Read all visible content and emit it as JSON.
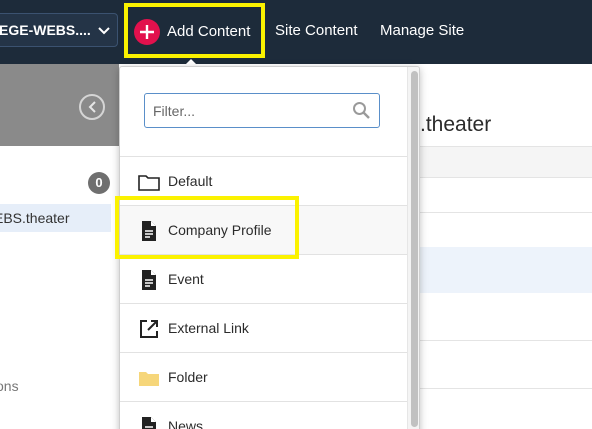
{
  "topbar": {
    "site_selector": "EGE-WEBS....",
    "add_content": "Add Content",
    "site_content": "Site Content",
    "manage_site": "Manage Site"
  },
  "left_panel": {
    "count": "0",
    "tree_item": "EBS.theater",
    "bottom_text": "ons"
  },
  "main": {
    "title_fragment": ".theater"
  },
  "dropdown": {
    "filter_placeholder": "Filter...",
    "filter_value": "",
    "items": [
      {
        "label": "Default",
        "icon": "folder-outline-icon"
      },
      {
        "label": "Company Profile",
        "icon": "document-icon"
      },
      {
        "label": "Event",
        "icon": "document-icon"
      },
      {
        "label": "External Link",
        "icon": "external-link-icon"
      },
      {
        "label": "Folder",
        "icon": "folder-filled-icon"
      },
      {
        "label": "News",
        "icon": "document-icon"
      }
    ]
  },
  "colors": {
    "topbar_bg": "#1d2b3a",
    "accent_plus": "#e2114d",
    "highlight": "#fbf200",
    "filter_border": "#5a8fc9",
    "folder_yellow": "#f6d67a"
  }
}
